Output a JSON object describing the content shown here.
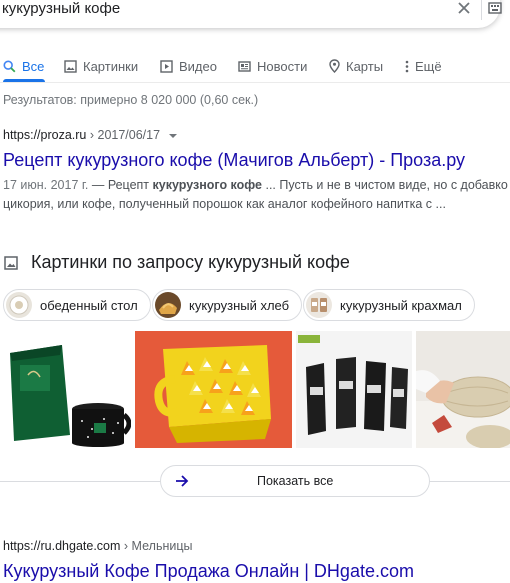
{
  "search": {
    "query": "кукурузный кофе"
  },
  "tabs": [
    {
      "label": "Все",
      "icon": "search-icon",
      "active": true
    },
    {
      "label": "Картинки",
      "icon": "image-icon"
    },
    {
      "label": "Видео",
      "icon": "video-icon"
    },
    {
      "label": "Новости",
      "icon": "news-icon"
    },
    {
      "label": "Карты",
      "icon": "map-pin-icon"
    },
    {
      "label": "Ещё",
      "icon": "more-vert-icon"
    }
  ],
  "result_stats": "Результатов: примерно 8 020 000 (0,60 сек.)",
  "results": [
    {
      "site": "https://proza.ru",
      "path": "› 2017/06/17",
      "title": "Рецепт кукурузного кофе (Мачигов Альберт) - Проза.ру",
      "date": "17 июн. 2017 г.",
      "snippet_line1_pre": " — Рецепт ",
      "snippet_line1_bold": "кукурузного кофе",
      "snippet_line1_post": " ... Пусть и не в чистом виде, но с добавкой",
      "snippet_line2": "цикория, или кофе, полученный порошок как аналог кофейного напитка с ..."
    },
    {
      "site": "https://ru.dhgate.com",
      "path": "› Мельницы",
      "title": "Кукурузный Кофе Продажа Онлайн | DHgate.com"
    }
  ],
  "images_section": {
    "title": "Картинки по запросу кукурузный кофе",
    "chips": [
      {
        "label": "обеденный стол"
      },
      {
        "label": "кукурузный хлеб"
      },
      {
        "label": "кукурузный крахмал"
      }
    ],
    "show_all_label": "Показать все"
  },
  "colors": {
    "link": "#1a0dab",
    "accent": "#1a73e8",
    "muted": "#70757a"
  }
}
